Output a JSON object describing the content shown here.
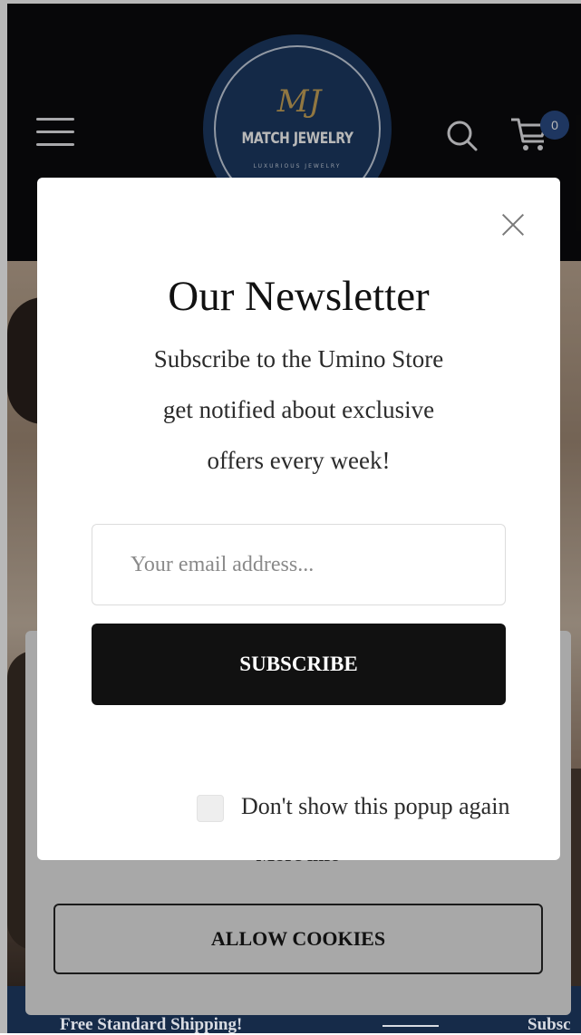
{
  "header": {
    "brand": "MATCH JEWELRY",
    "brand_mark": "MJ",
    "tagline": "LUXURIOUS JEWELRY",
    "cart_count": "0"
  },
  "popup": {
    "title": "Our Newsletter",
    "description_lines": [
      "Subscribe to the Umino Store",
      "get notified about exclusive",
      "offers every week!"
    ],
    "email_placeholder": "Your email address...",
    "subscribe_label": "SUBSCRIBE",
    "dont_show_label": "Don't show this popup again"
  },
  "cookie": {
    "more_info": "More info",
    "allow_label": "ALLOW COOKIES"
  },
  "ticker": {
    "item1": "Free Standard Shipping!",
    "item2": "Subsc"
  },
  "colors": {
    "header_bg": "#0b0b0d",
    "logo_bg": "#1d3a63",
    "logo_gold": "#c9a55b",
    "topbar_bg": "#1f3c66",
    "button_dark": "#111111",
    "cookie_bg": "#a8a8a8"
  },
  "icons": [
    "menu-icon",
    "search-icon",
    "cart-icon",
    "close-icon",
    "checkbox-icon"
  ]
}
